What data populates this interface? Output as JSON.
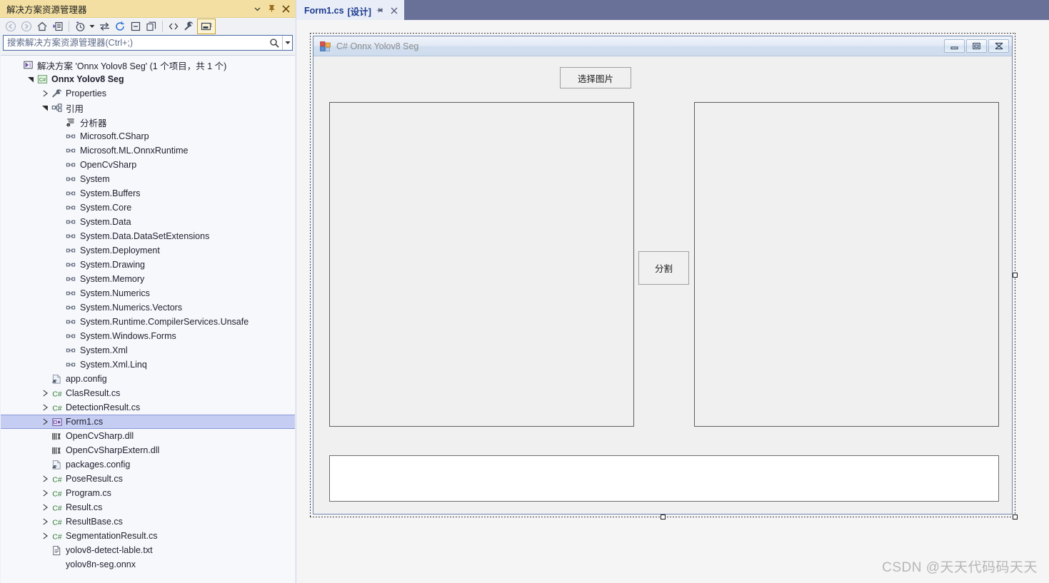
{
  "solution_explorer": {
    "title": "解决方案资源管理器",
    "title_buttons": [
      {
        "name": "dropdown",
        "glyph": "▾"
      },
      {
        "name": "pin",
        "glyph": "pin-icon"
      },
      {
        "name": "close",
        "glyph": "✕"
      }
    ],
    "toolbar": [
      {
        "name": "back",
        "icon": "back-arrow-icon"
      },
      {
        "name": "forward",
        "icon": "forward-arrow-icon"
      },
      {
        "name": "home",
        "icon": "home-icon"
      },
      {
        "name": "pending-changes",
        "icon": "pending-changes-icon"
      },
      {
        "name": "sep1",
        "icon": "separator"
      },
      {
        "name": "history",
        "icon": "clock-icon"
      },
      {
        "name": "history-dropdown",
        "icon": "caret-down-icon"
      },
      {
        "name": "sync-with-active-document",
        "icon": "sync-arrows-icon"
      },
      {
        "name": "refresh",
        "icon": "refresh-icon"
      },
      {
        "name": "collapse-all",
        "icon": "collapse-all-icon"
      },
      {
        "name": "show-all-files",
        "icon": "show-all-files-icon"
      },
      {
        "name": "sep2",
        "icon": "separator"
      },
      {
        "name": "view-code",
        "icon": "angle-brackets-icon"
      },
      {
        "name": "properties",
        "icon": "wrench-icon"
      },
      {
        "name": "view-designer",
        "icon": "designer-icon",
        "active": true
      }
    ],
    "search": {
      "placeholder": "搜索解决方案资源管理器(Ctrl+;)",
      "value": "",
      "icon": "magnifier-icon",
      "caret": "▾"
    },
    "tree": [
      {
        "indent": 0,
        "arrow": "none",
        "icon": "solution-icon",
        "label": "解决方案 'Onnx Yolov8 Seg' (1 个项目，共 1 个)",
        "bold": false
      },
      {
        "indent": 1,
        "arrow": "expanded",
        "icon": "csproj-icon",
        "label": "Onnx Yolov8 Seg",
        "bold": true
      },
      {
        "indent": 2,
        "arrow": "collapsed",
        "icon": "wrench-icon",
        "label": "Properties",
        "bold": false
      },
      {
        "indent": 2,
        "arrow": "expanded",
        "icon": "references-icon",
        "label": "引用",
        "bold": false
      },
      {
        "indent": 3,
        "arrow": "none",
        "icon": "analyzer-icon",
        "label": "分析器",
        "bold": false
      },
      {
        "indent": 3,
        "arrow": "none",
        "icon": "reference-icon",
        "label": "Microsoft.CSharp",
        "bold": false
      },
      {
        "indent": 3,
        "arrow": "none",
        "icon": "reference-icon",
        "label": "Microsoft.ML.OnnxRuntime",
        "bold": false
      },
      {
        "indent": 3,
        "arrow": "none",
        "icon": "reference-icon",
        "label": "OpenCvSharp",
        "bold": false
      },
      {
        "indent": 3,
        "arrow": "none",
        "icon": "reference-icon",
        "label": "System",
        "bold": false
      },
      {
        "indent": 3,
        "arrow": "none",
        "icon": "reference-icon",
        "label": "System.Buffers",
        "bold": false
      },
      {
        "indent": 3,
        "arrow": "none",
        "icon": "reference-icon",
        "label": "System.Core",
        "bold": false
      },
      {
        "indent": 3,
        "arrow": "none",
        "icon": "reference-icon",
        "label": "System.Data",
        "bold": false
      },
      {
        "indent": 3,
        "arrow": "none",
        "icon": "reference-icon",
        "label": "System.Data.DataSetExtensions",
        "bold": false
      },
      {
        "indent": 3,
        "arrow": "none",
        "icon": "reference-icon",
        "label": "System.Deployment",
        "bold": false
      },
      {
        "indent": 3,
        "arrow": "none",
        "icon": "reference-icon",
        "label": "System.Drawing",
        "bold": false
      },
      {
        "indent": 3,
        "arrow": "none",
        "icon": "reference-icon",
        "label": "System.Memory",
        "bold": false
      },
      {
        "indent": 3,
        "arrow": "none",
        "icon": "reference-icon",
        "label": "System.Numerics",
        "bold": false
      },
      {
        "indent": 3,
        "arrow": "none",
        "icon": "reference-icon",
        "label": "System.Numerics.Vectors",
        "bold": false
      },
      {
        "indent": 3,
        "arrow": "none",
        "icon": "reference-icon",
        "label": "System.Runtime.CompilerServices.Unsafe",
        "bold": false
      },
      {
        "indent": 3,
        "arrow": "none",
        "icon": "reference-icon",
        "label": "System.Windows.Forms",
        "bold": false
      },
      {
        "indent": 3,
        "arrow": "none",
        "icon": "reference-icon",
        "label": "System.Xml",
        "bold": false
      },
      {
        "indent": 3,
        "arrow": "none",
        "icon": "reference-icon",
        "label": "System.Xml.Linq",
        "bold": false
      },
      {
        "indent": 2,
        "arrow": "none",
        "icon": "config-icon",
        "label": "app.config",
        "bold": false
      },
      {
        "indent": 2,
        "arrow": "collapsed",
        "icon": "csharp-icon",
        "label": "ClasResult.cs",
        "bold": false
      },
      {
        "indent": 2,
        "arrow": "collapsed",
        "icon": "csharp-icon",
        "label": "DetectionResult.cs",
        "bold": false
      },
      {
        "indent": 2,
        "arrow": "collapsed",
        "icon": "form-icon",
        "label": "Form1.cs",
        "bold": false,
        "selected": true
      },
      {
        "indent": 2,
        "arrow": "none",
        "icon": "dll-icon",
        "label": "OpenCvSharp.dll",
        "bold": false
      },
      {
        "indent": 2,
        "arrow": "none",
        "icon": "dll-icon",
        "label": "OpenCvSharpExtern.dll",
        "bold": false
      },
      {
        "indent": 2,
        "arrow": "none",
        "icon": "config-icon",
        "label": "packages.config",
        "bold": false
      },
      {
        "indent": 2,
        "arrow": "collapsed",
        "icon": "csharp-icon",
        "label": "PoseResult.cs",
        "bold": false
      },
      {
        "indent": 2,
        "arrow": "collapsed",
        "icon": "csharp-icon",
        "label": "Program.cs",
        "bold": false
      },
      {
        "indent": 2,
        "arrow": "collapsed",
        "icon": "csharp-icon",
        "label": "Result.cs",
        "bold": false
      },
      {
        "indent": 2,
        "arrow": "collapsed",
        "icon": "csharp-icon",
        "label": "ResultBase.cs",
        "bold": false
      },
      {
        "indent": 2,
        "arrow": "collapsed",
        "icon": "csharp-icon",
        "label": "SegmentationResult.cs",
        "bold": false
      },
      {
        "indent": 2,
        "arrow": "none",
        "icon": "text-file-icon",
        "label": "yolov8-detect-lable.txt",
        "bold": false
      },
      {
        "indent": 2,
        "arrow": "none",
        "icon": "none",
        "label": "yolov8n-seg.onnx",
        "bold": false
      }
    ]
  },
  "editor": {
    "tab": {
      "title": "Form1.cs",
      "suffix": "[设计]",
      "pin_glyph": "⊐",
      "close_glyph": "✕"
    }
  },
  "designer": {
    "form": {
      "title": "C# Onnx Yolov8 Seg",
      "icon": "winforms-icon",
      "window_buttons": [
        {
          "name": "minimize-button",
          "glyph": "minimize-icon"
        },
        {
          "name": "maximize-button",
          "glyph": "maximize-icon"
        },
        {
          "name": "close-button",
          "glyph": "close-icon"
        }
      ],
      "controls": {
        "select_image_button": {
          "label": "选择图片"
        },
        "segment_button": {
          "label": "分割"
        },
        "left_picturebox": {
          "label": ""
        },
        "right_picturebox": {
          "label": ""
        },
        "result_textbox": {
          "value": ""
        }
      }
    }
  },
  "watermark": {
    "text": "CSDN @天天代码码天天"
  },
  "colors": {
    "panel_title_bg": "#f2dfa1",
    "tabstrip_bg": "#6a7199",
    "tab_bg": "#e9edf7",
    "tab_text": "#1b3a8f",
    "tree_bg": "#f7f8fc",
    "selection_bg": "#c5cdf2",
    "form_bg": "#f0f0f0",
    "canvas_bg": "#f5f5f5"
  }
}
